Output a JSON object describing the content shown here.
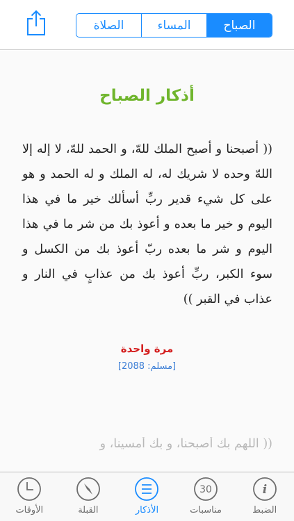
{
  "header": {
    "segments": [
      {
        "label": "الصلاة"
      },
      {
        "label": "المساء"
      },
      {
        "label": "الصباح",
        "active": true
      }
    ]
  },
  "content": {
    "title": "أذكار الصباح",
    "dhikr_text": "(( أصبحنا و أصبح الملك للهّ، و الحمد للهّ، لا إله إلا اللهّ وحده لا شريك له، له الملك و له الحمد و هو على كل شيء قدير ربِّ أسألك خير ما في هذا اليوم و خير ما بعده و أعوذ بك من شر ما في هذا اليوم و شر ما بعده ربّ أعوذ بك من الكسل و سوء الكبر، ربِّ أعوذ بك من عذابٍ في النار و عذاب في القبر ))",
    "count": "مرة واحدة",
    "source": "[مسلم: 2088]",
    "next_dhikr_preview": "(( اللهم بك أصبحنا، و بك أمسينا، و"
  },
  "tabbar": {
    "tabs": [
      {
        "label": "الأوقات",
        "icon": "clock-icon"
      },
      {
        "label": "القبلة",
        "icon": "compass-icon"
      },
      {
        "label": "الأذكار",
        "icon": "list-icon",
        "active": true
      },
      {
        "label": "مناسبات",
        "icon": "calendar-30-icon",
        "badge": "30"
      },
      {
        "label": "الضبط",
        "icon": "info-icon",
        "glyph": "i"
      }
    ]
  },
  "colors": {
    "accent": "#1a8cff",
    "title_green": "#6fb52c",
    "count_red": "#d42020",
    "source_blue": "#3d7fd6"
  }
}
